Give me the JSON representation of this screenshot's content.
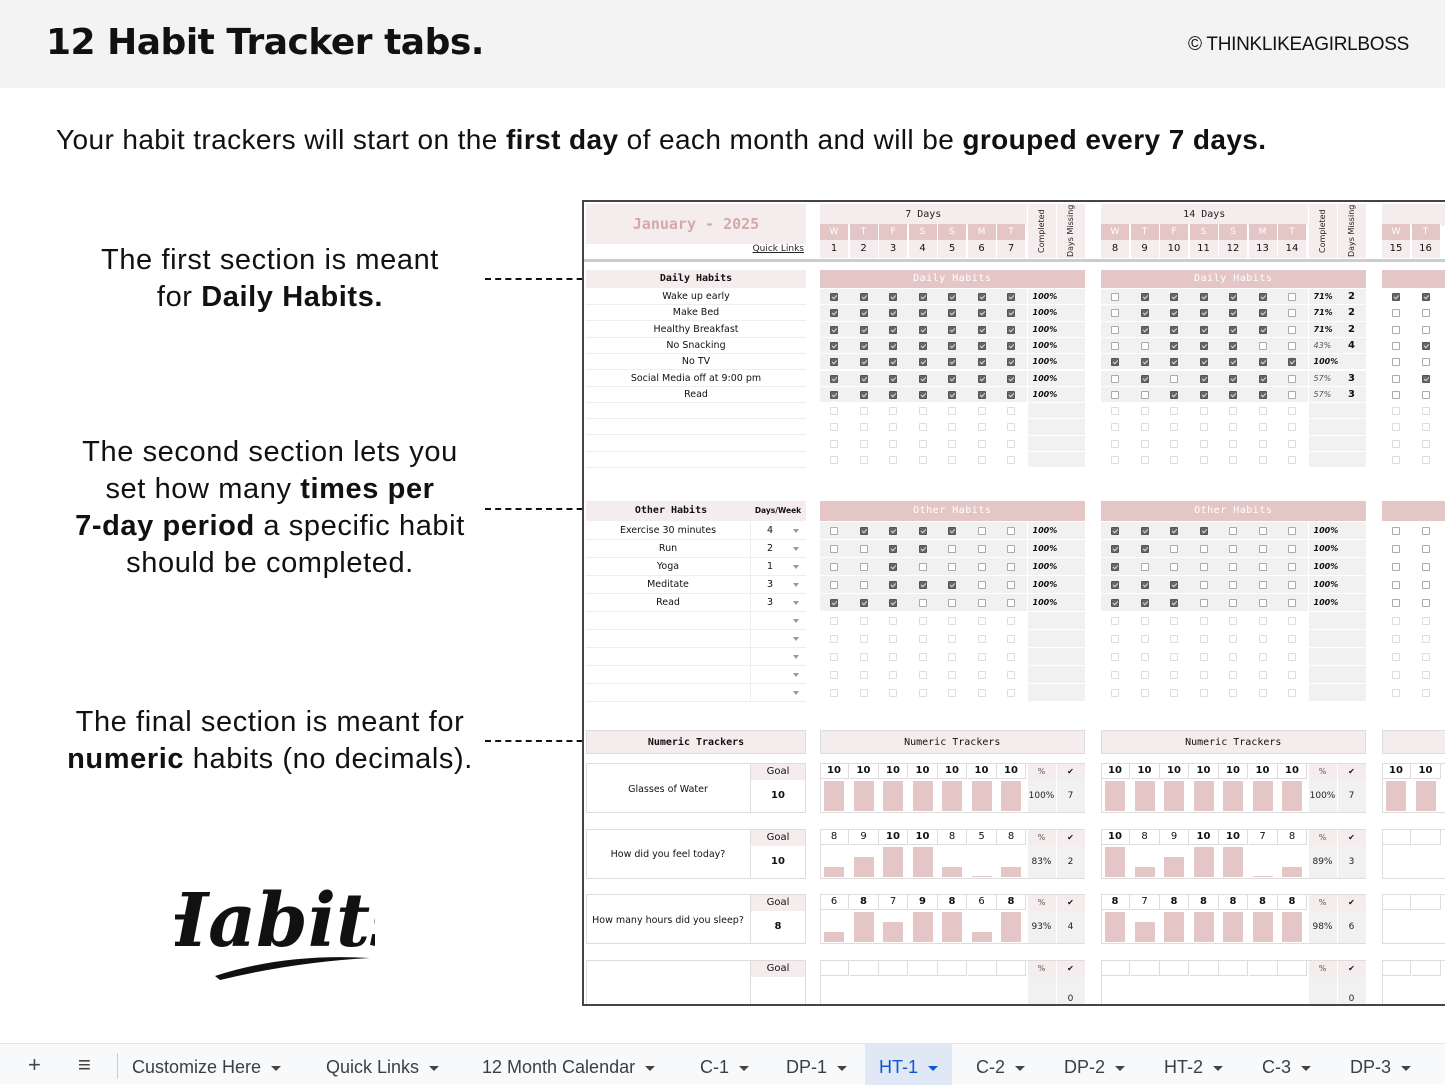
{
  "header": {
    "title": "12 Habit Tracker tabs.",
    "copyright": "© THINKLIKEAGIRLBOSS"
  },
  "subtitle": {
    "p1": "Your habit trackers will start on the ",
    "b1": "first day",
    "p2": " of each month and will be ",
    "b2": "grouped every 7 days."
  },
  "notes": {
    "daily": {
      "l1": "The first section is meant",
      "l2a": "for ",
      "l2b": "Daily Habits."
    },
    "other": {
      "l1": "The second section lets you",
      "l2a": "set how many ",
      "l2b": "times per",
      "l3a": "7-day period",
      "l3b": " a specific habit",
      "l4": "should be completed."
    },
    "numeric": {
      "l1": "The final section is meant for",
      "l2a": "numeric",
      "l2b": " habits (no decimals)."
    }
  },
  "logo_text": "Habits",
  "sheet": {
    "month": "January  -  2025",
    "quick_links": "Quick Links",
    "completed_label": "Completed",
    "days_missing_label": "Days Missing",
    "weeks": [
      {
        "title": "7 Days",
        "letters": [
          "W",
          "T",
          "F",
          "S",
          "S",
          "M",
          "T"
        ],
        "days": [
          "1",
          "2",
          "3",
          "4",
          "5",
          "6",
          "7"
        ]
      },
      {
        "title": "14 Days",
        "letters": [
          "W",
          "T",
          "F",
          "S",
          "S",
          "M",
          "T"
        ],
        "days": [
          "8",
          "9",
          "10",
          "11",
          "12",
          "13",
          "14"
        ]
      },
      {
        "title": "",
        "letters": [
          "W",
          "T"
        ],
        "days": [
          "15",
          "16"
        ]
      }
    ],
    "daily": {
      "header": "Daily Habits",
      "habits": [
        "Wake up early",
        "Make Bed",
        "Healthy Breakfast",
        "No Snacking",
        "No TV",
        "Social Media off at 9:00 pm",
        "Read"
      ],
      "empty_rows": 4,
      "weeks": [
        {
          "checks": [
            [
              1,
              1,
              1,
              1,
              1,
              1,
              1
            ],
            [
              1,
              1,
              1,
              1,
              1,
              1,
              1
            ],
            [
              1,
              1,
              1,
              1,
              1,
              1,
              1
            ],
            [
              1,
              1,
              1,
              1,
              1,
              1,
              1
            ],
            [
              1,
              1,
              1,
              1,
              1,
              1,
              1
            ],
            [
              1,
              1,
              1,
              1,
              1,
              1,
              1
            ],
            [
              1,
              1,
              1,
              1,
              1,
              1,
              1
            ]
          ],
          "completed": [
            "100%",
            "100%",
            "100%",
            "100%",
            "100%",
            "100%",
            "100%"
          ],
          "missing": [
            "",
            "",
            "",
            "",
            "",
            "",
            ""
          ]
        },
        {
          "checks": [
            [
              0,
              1,
              1,
              1,
              1,
              1,
              0
            ],
            [
              0,
              1,
              1,
              1,
              1,
              1,
              0
            ],
            [
              0,
              1,
              1,
              1,
              1,
              1,
              0
            ],
            [
              0,
              0,
              1,
              1,
              1,
              0,
              0
            ],
            [
              1,
              1,
              1,
              1,
              1,
              1,
              1
            ],
            [
              0,
              1,
              0,
              1,
              1,
              1,
              0
            ],
            [
              0,
              0,
              1,
              1,
              1,
              1,
              0
            ]
          ],
          "completed": [
            "71%",
            "71%",
            "71%",
            "43%",
            "100%",
            "57%",
            "57%"
          ],
          "missing": [
            "2",
            "2",
            "2",
            "4",
            "",
            "3",
            "3"
          ]
        },
        {
          "checks": [
            [
              1,
              1
            ],
            [
              0,
              0
            ],
            [
              0,
              0
            ],
            [
              0,
              1
            ],
            [
              0,
              0
            ],
            [
              0,
              1
            ],
            [
              0,
              0
            ]
          ]
        }
      ]
    },
    "other": {
      "header": "Other Habits",
      "days_week_label": "Days/Week",
      "habits": [
        {
          "name": "Exercise 30 minutes",
          "days": "4"
        },
        {
          "name": "Run",
          "days": "2"
        },
        {
          "name": "Yoga",
          "days": "1"
        },
        {
          "name": "Meditate",
          "days": "3"
        },
        {
          "name": "Read",
          "days": "3"
        }
      ],
      "empty_rows": 5,
      "weeks": [
        {
          "checks": [
            [
              0,
              1,
              1,
              1,
              1,
              0,
              0
            ],
            [
              0,
              0,
              1,
              1,
              0,
              0,
              0
            ],
            [
              0,
              0,
              1,
              0,
              0,
              0,
              0
            ],
            [
              0,
              0,
              1,
              1,
              1,
              0,
              0
            ],
            [
              1,
              1,
              1,
              0,
              0,
              0,
              0
            ]
          ],
          "completed": [
            "100%",
            "100%",
            "100%",
            "100%",
            "100%"
          ]
        },
        {
          "checks": [
            [
              1,
              1,
              1,
              1,
              0,
              0,
              0
            ],
            [
              1,
              1,
              0,
              0,
              0,
              0,
              0
            ],
            [
              1,
              0,
              0,
              0,
              0,
              0,
              0
            ],
            [
              1,
              1,
              1,
              0,
              0,
              0,
              0
            ],
            [
              1,
              1,
              1,
              0,
              0,
              0,
              0
            ]
          ],
          "completed": [
            "100%",
            "100%",
            "100%",
            "100%",
            "100%"
          ]
        },
        {
          "checks": [
            [
              0,
              0
            ],
            [
              0,
              0
            ],
            [
              0,
              0
            ],
            [
              0,
              0
            ],
            [
              0,
              0
            ]
          ]
        }
      ]
    },
    "numeric": {
      "header": "Numeric Trackers",
      "goal_label": "Goal",
      "pct_label": "%",
      "check_label": "✔",
      "trackers": [
        {
          "name": "Glasses of Water",
          "goal": "10",
          "weeks": [
            {
              "values": [
                10,
                10,
                10,
                10,
                10,
                10,
                10
              ],
              "pct": "100%",
              "hits": "7"
            },
            {
              "values": [
                10,
                10,
                10,
                10,
                10,
                10,
                10
              ],
              "pct": "100%",
              "hits": "7"
            },
            {
              "values": [
                10,
                10
              ]
            }
          ]
        },
        {
          "name": "How did you feel today?",
          "goal": "10",
          "weeks": [
            {
              "values": [
                8,
                9,
                10,
                10,
                8,
                5,
                8
              ],
              "pct": "83%",
              "hits": "2"
            },
            {
              "values": [
                10,
                8,
                9,
                10,
                10,
                7,
                8
              ],
              "pct": "89%",
              "hits": "3"
            },
            {
              "values": []
            }
          ]
        },
        {
          "name": "How many hours did you sleep?",
          "goal": "8",
          "weeks": [
            {
              "values": [
                6,
                8,
                7,
                9,
                8,
                6,
                8
              ],
              "pct": "93%",
              "hits": "4"
            },
            {
              "values": [
                8,
                7,
                8,
                8,
                8,
                8,
                8
              ],
              "pct": "98%",
              "hits": "6"
            },
            {
              "values": []
            }
          ]
        },
        {
          "name": "",
          "goal": "",
          "weeks": [
            {
              "values": [],
              "pct": "",
              "hits": "0"
            },
            {
              "values": [],
              "pct": "",
              "hits": "0"
            },
            {
              "values": []
            }
          ]
        }
      ]
    }
  },
  "tabbar": {
    "add_icon": "+",
    "menu_icon": "≡",
    "tabs": [
      {
        "label": "Customize Here",
        "active": false
      },
      {
        "label": "Quick Links",
        "active": false
      },
      {
        "label": "12 Month Calendar",
        "active": false
      },
      {
        "label": "C-1",
        "active": false
      },
      {
        "label": "DP-1",
        "active": false
      },
      {
        "label": "HT-1",
        "active": true
      },
      {
        "label": "C-2",
        "active": false
      },
      {
        "label": "DP-2",
        "active": false
      },
      {
        "label": "HT-2",
        "active": false
      },
      {
        "label": "C-3",
        "active": false
      },
      {
        "label": "DP-3",
        "active": false
      }
    ]
  }
}
